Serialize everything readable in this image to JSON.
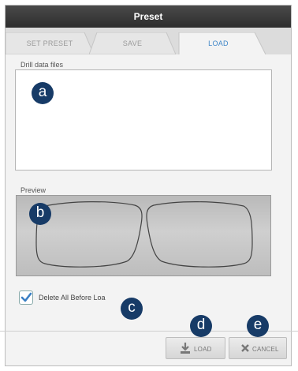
{
  "window": {
    "title": "Preset"
  },
  "tabs": [
    {
      "label": "SET PRESET",
      "active": false
    },
    {
      "label": "SAVE",
      "active": false
    },
    {
      "label": "LOAD",
      "active": true
    }
  ],
  "files_section": {
    "label": "Drill data files"
  },
  "preview_section": {
    "label": "Preview"
  },
  "options": {
    "delete_all_label": "Delete All Before Loa",
    "delete_all_checked": true
  },
  "buttons": {
    "load_label": "LOAD",
    "cancel_label": "CANCEL"
  },
  "markers": [
    "a",
    "b",
    "c",
    "d",
    "e"
  ],
  "colors": {
    "active_tab": "#3f86c8",
    "marker": "#173b67",
    "titlebar": "#3a3a3a",
    "checkbox_mark": "#3a7fc4"
  },
  "icons": {
    "load": "download-icon",
    "cancel": "close-icon",
    "checkbox": "checkmark-icon"
  }
}
